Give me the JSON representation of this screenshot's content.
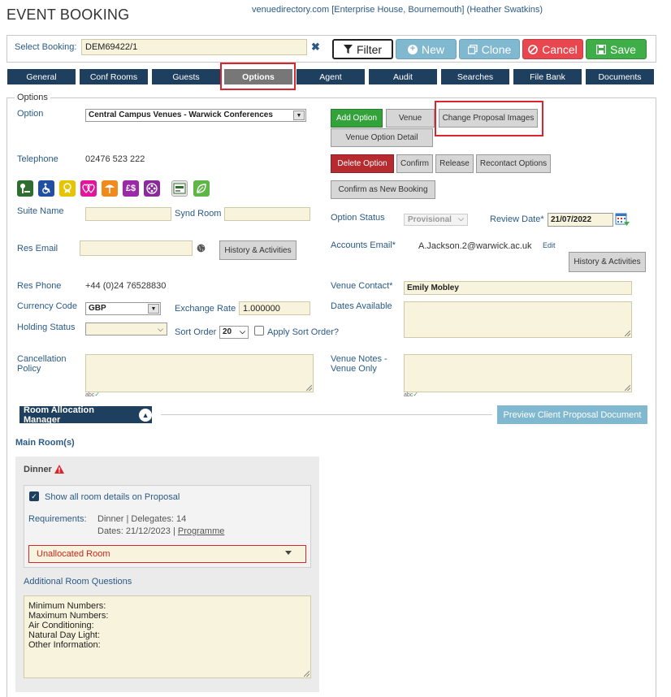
{
  "header": {
    "title": "EVENT BOOKING",
    "context": "venuedirectory.com [Enterprise House, Bournemouth] (Heather Swatkins)"
  },
  "booking": {
    "label": "Select Booking:",
    "value": "DEM69422/1",
    "clear": "✖"
  },
  "toolbar": {
    "filter": "Filter",
    "new": "New",
    "clone": "Clone",
    "cancel": "Cancel",
    "save": "Save"
  },
  "tabs": [
    "General",
    "Conf Rooms",
    "Guests",
    "Options",
    "Agent",
    "Audit",
    "Searches",
    "File Bank",
    "Documents"
  ],
  "active_tab": "Options",
  "options": {
    "legend": "Options",
    "option_label": "Option",
    "option_value": "Central Campus Venues - Warwick Conferences",
    "telephone_label": "Telephone",
    "telephone_value": "02476 523 222",
    "suite_name_label": "Suite Name",
    "synd_room_label": "Synd Room",
    "res_email_label": "Res Email",
    "res_phone_label": "Res Phone",
    "res_phone_value": "+44 (0)24 76528830",
    "currency_label": "Currency Code",
    "currency_value": "GBP",
    "exchange_label": "Exchange Rate",
    "exchange_value": "1.000000",
    "holding_label": "Holding Status",
    "holding_value": "",
    "sort_order_label": "Sort Order",
    "sort_order_value": "20",
    "apply_sort_label": "Apply Sort Order?",
    "cancellation_label_1": "Cancellation",
    "cancellation_label_2": "Policy",
    "history_btn": "History & Activities",
    "buttons": {
      "add_option": "Add Option",
      "venue": "Venue",
      "change_images": "Change Proposal Images",
      "venue_option_detail": "Venue Option Detail",
      "delete_option": "Delete Option",
      "confirm": "Confirm",
      "release": "Release",
      "recontact": "Recontact Options",
      "confirm_new": "Confirm as New Booking"
    },
    "option_status_label": "Option Status",
    "option_status_value": "Provisional",
    "review_date_label": "Review Date*",
    "review_date_value": "21/07/2022",
    "accounts_email_label": "Accounts Email*",
    "accounts_email_value": "A.Jackson.2@warwick.ac.uk",
    "edit_link": "Edit",
    "history_btn_2": "History & Activities",
    "venue_contact_label": "Venue Contact*",
    "venue_contact_value": "Emily Mobley",
    "dates_available_label": "Dates Available",
    "venue_notes_label_1": "Venue Notes -",
    "venue_notes_label_2": "Venue Only",
    "spell": "abc"
  },
  "room_manager": {
    "title": "Room Allocation Manager",
    "preview": "Preview Client Proposal Document",
    "main_rooms": "Main Room(s)",
    "room_name": "Dinner",
    "show_details": "Show all room details on Proposal",
    "requirements_label": "Requirements:",
    "requirements_line1": "Dinner | Delegates: 14",
    "requirements_line2_prefix": "Dates: 21/12/2023 |",
    "programme_link": "Programme",
    "allocation": "Unallocated Room",
    "additional_questions": "Additional Room Questions",
    "questions": [
      "Minimum Numbers:",
      "Maximum Numbers:",
      "Air Conditioning:",
      "Natural Day Light:",
      "Other Information:"
    ]
  },
  "colors": {
    "nav": "#1f3f5f",
    "accent_blue": "#2a5a86",
    "highlight": "#d9262e",
    "save_green": "#3fae48",
    "cancel_red": "#e8474f",
    "input_bg": "#f7f3dc"
  },
  "facility_icons": [
    "parking-icon",
    "accessibility-icon",
    "award-icon",
    "hearts-icon",
    "beach-icon",
    "money-icon",
    "film-icon",
    "safe-icon",
    "leaf-icon"
  ]
}
